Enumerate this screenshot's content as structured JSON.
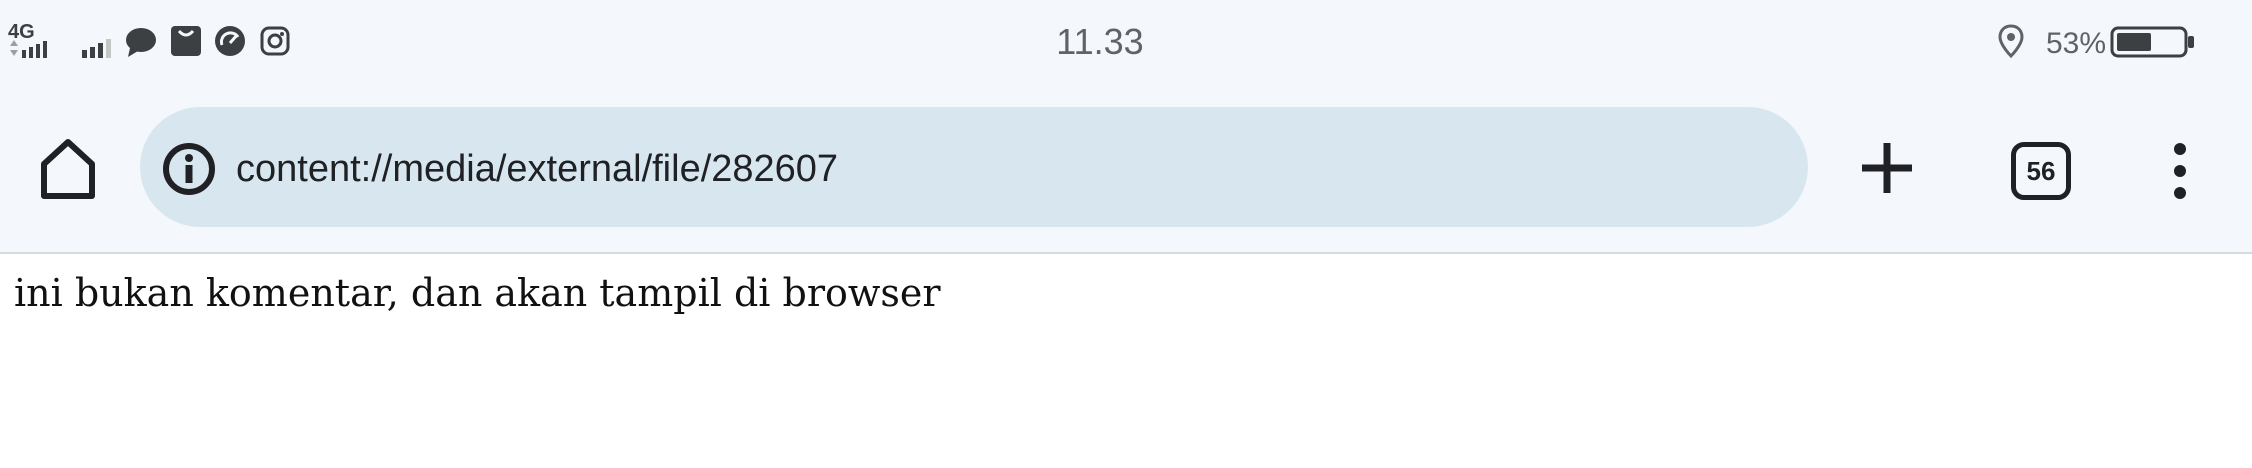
{
  "status_bar": {
    "network_label": "4G",
    "time": "11.33",
    "battery_percent": "53%",
    "icons": [
      "signal-icon",
      "signal-icon",
      "chat-icon",
      "shopping-bag-icon",
      "speedometer-icon",
      "instagram-icon",
      "location-icon",
      "battery-icon"
    ]
  },
  "toolbar": {
    "url": "content://media/external/file/282607",
    "tab_count": "56",
    "icons": [
      "home-icon",
      "info-icon",
      "new-tab-plus-icon",
      "tab-switcher-icon",
      "more-menu-icon"
    ]
  },
  "page": {
    "body_text": "ini bukan komentar, dan akan tampil di browser"
  }
}
